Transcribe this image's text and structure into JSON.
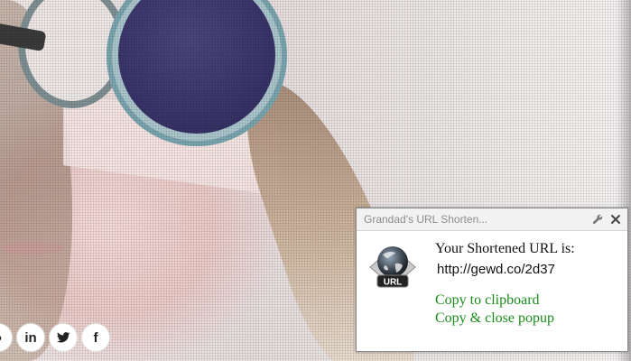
{
  "popup": {
    "title": "Grandad's URL Shorten...",
    "label": "Your Shortened URL is:",
    "short_url": "http://gewd.co/2d37",
    "copy_label": "Copy to clipboard",
    "copy_close_label": "Copy & close popup",
    "logo_text": "URL",
    "action_color": "#1b8c1b"
  },
  "social": {
    "icons": [
      "partial-icon",
      "linkedin-icon",
      "twitter-icon",
      "facebook-icon"
    ],
    "linkedin_label": "in",
    "facebook_label": "f"
  }
}
